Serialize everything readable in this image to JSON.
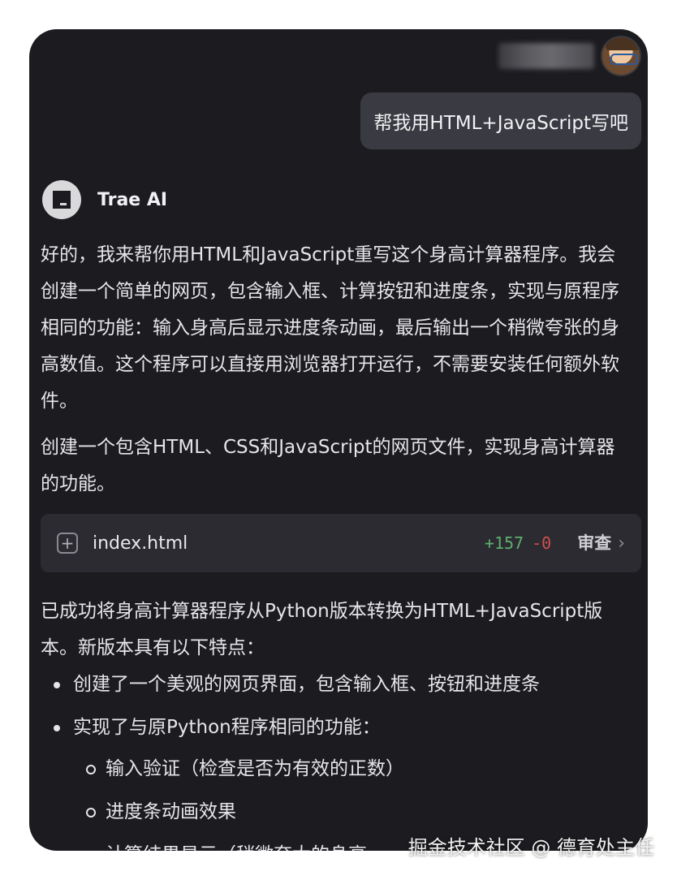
{
  "user": {
    "message": "帮我用HTML+JavaScript写吧"
  },
  "ai": {
    "name": "Trae AI",
    "intro": "好的，我来帮你用HTML和JavaScript重写这个身高计算器程序。我会创建一个简单的网页，包含输入框、计算按钮和进度条，实现与原程序相同的功能：输入身高后显示进度条动画，最后输出一个稍微夸张的身高数值。这个程序可以直接用浏览器打开运行，不需要安装任何额外软件。",
    "task": "创建一个包含HTML、CSS和JavaScript的网页文件，实现身高计算器的功能。",
    "file_card": {
      "file_name": "index.html",
      "additions": "+157",
      "deletions": "-0",
      "review_label": "审查"
    },
    "summary": "已成功将身高计算器程序从Python版本转换为HTML+JavaScript版本。新版本具有以下特点：",
    "bullets": [
      "创建了一个美观的网页界面，包含输入框、按钮和进度条",
      "实现了与原Python程序相同的功能："
    ],
    "sub_bullets": [
      "输入验证（检查是否为有效的正数）",
      "进度条动画效果",
      "计算结果显示（稍微夸大的身高"
    ]
  },
  "watermark": "掘金技术社区 @ 德育处主任"
}
